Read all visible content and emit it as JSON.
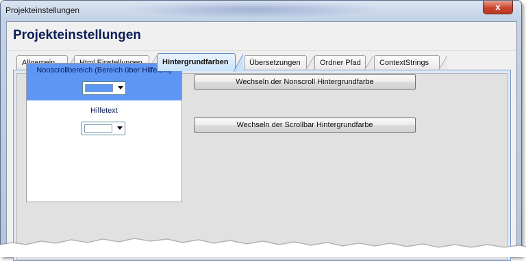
{
  "window": {
    "title": "Projekteinstellungen",
    "close_label": "x"
  },
  "header": {
    "title": "Projekteinstellungen"
  },
  "tabs": [
    {
      "label": "Allgemein",
      "active": false
    },
    {
      "label": "Html Einstellungen",
      "active": false
    },
    {
      "label": "Hintergrundfarben",
      "active": true
    },
    {
      "label": "Übersetzungen",
      "active": false
    },
    {
      "label": "Ordner Pfad",
      "active": false
    },
    {
      "label": "ContextStrings",
      "active": false
    }
  ],
  "preview": {
    "nonscroll_label": "Nonscrollbereich (Bereich über Hilfetext)",
    "nonscroll_color": "#5e96f5",
    "hilfetext_label": "Hilfetext",
    "hilfetext_color": "#ffffff"
  },
  "buttons": {
    "change_nonscroll": "Wechseln der Nonscroll Hintergrundfarbe",
    "change_scrollbar": "Wechseln der Scrollbar Hintergrundfarbe"
  },
  "colors": {
    "title_text": "#0b1d56",
    "active_tab": "#c9e2fb",
    "panel_background": "#e1e1e1"
  }
}
